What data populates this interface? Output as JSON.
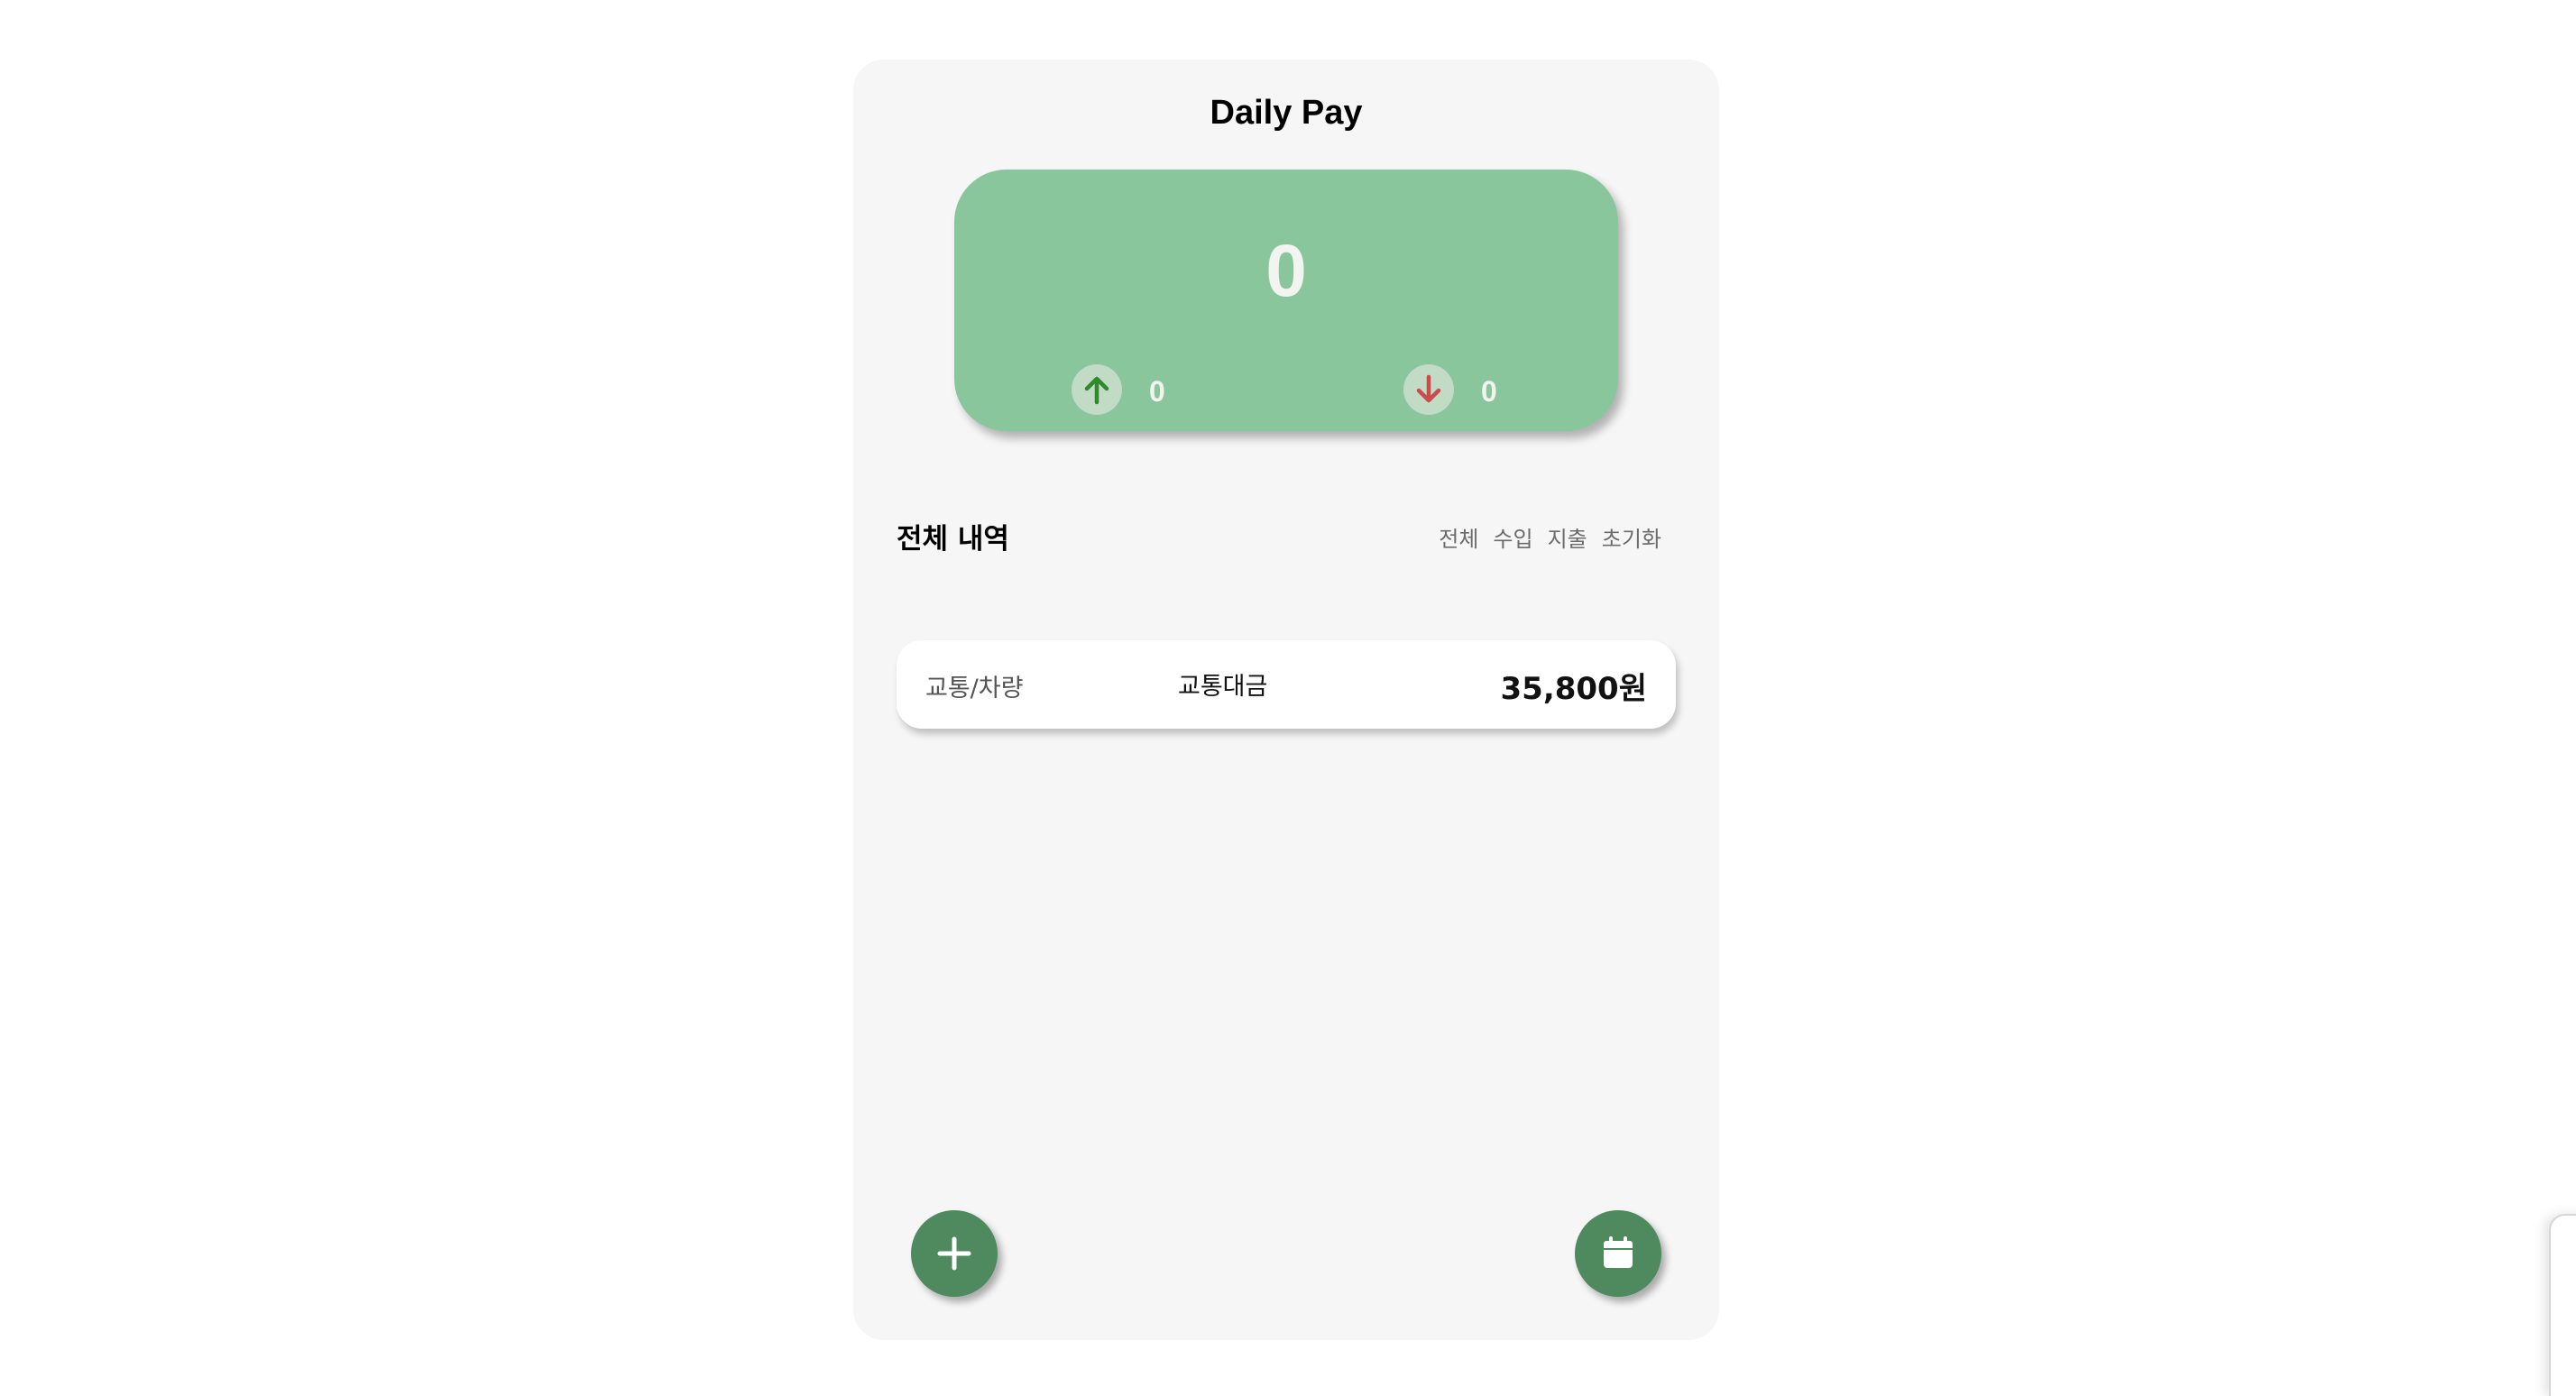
{
  "app": {
    "title": "Daily Pay"
  },
  "balance": {
    "total": "0",
    "income": "0",
    "expense": "0",
    "card_color": "#89c69b",
    "income_arrow_color": "#2f8a2c",
    "expense_arrow_color": "#cc4b4b"
  },
  "history": {
    "title": "전체 내역",
    "filters": [
      "전체",
      "수입",
      "지출",
      "초기화"
    ]
  },
  "transactions": [
    {
      "category": "교통/차량",
      "memo": "교통대금",
      "amount": "35,800원"
    }
  ],
  "actions": {
    "add_icon": "plus-icon",
    "calendar_icon": "calendar-icon",
    "fab_color": "#4e8a5e"
  }
}
